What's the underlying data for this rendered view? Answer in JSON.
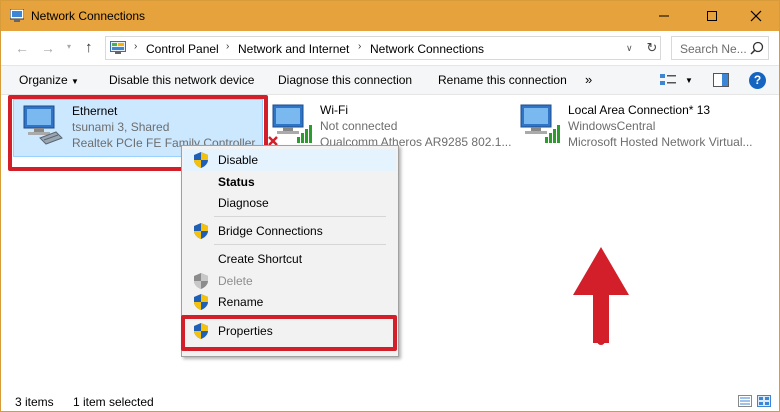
{
  "window": {
    "title": "Network Connections",
    "accent_color": "#e6a23c"
  },
  "titlebar": {
    "minimize_icon": "minimize-icon",
    "maximize_icon": "maximize-icon",
    "close_icon": "close-icon"
  },
  "address": {
    "breadcrumbs": [
      "Control Panel",
      "Network and Internet",
      "Network Connections"
    ],
    "search_placeholder": "Search Ne..."
  },
  "toolbar": {
    "organize": "Organize",
    "disable_device": "Disable this network device",
    "diagnose": "Diagnose this connection",
    "rename": "Rename this connection",
    "more": "»"
  },
  "connections": [
    {
      "name": "Ethernet",
      "line1": "tsunami  3, Shared",
      "line2": "Realtek PCIe FE Family Controller",
      "selected": true
    },
    {
      "name": "Wi-Fi",
      "line1": "Not connected",
      "line2": "Qualcomm Atheros AR9285 802.1..."
    },
    {
      "name": "Local Area Connection* 13",
      "line1": "WindowsCentral",
      "line2": "Microsoft Hosted Network Virtual..."
    }
  ],
  "context_menu": {
    "items": [
      {
        "label": "Disable",
        "shield": true,
        "bold": false,
        "disabled": false
      },
      {
        "label": "Status",
        "shield": false,
        "bold": true,
        "disabled": false
      },
      {
        "label": "Diagnose",
        "shield": false,
        "bold": false,
        "disabled": false
      },
      {
        "label": "Bridge Connections",
        "shield": true,
        "bold": false,
        "disabled": false
      },
      {
        "label": "Create Shortcut",
        "shield": false,
        "bold": false,
        "disabled": false
      },
      {
        "label": "Delete",
        "shield": true,
        "bold": false,
        "disabled": true
      },
      {
        "label": "Rename",
        "shield": true,
        "bold": false,
        "disabled": false
      },
      {
        "label": "Properties",
        "shield": true,
        "bold": false,
        "disabled": false
      }
    ]
  },
  "status": {
    "items_count": "3 items",
    "selected": "1 item selected"
  },
  "annotation": {
    "highlight_color": "#d21f2a"
  }
}
